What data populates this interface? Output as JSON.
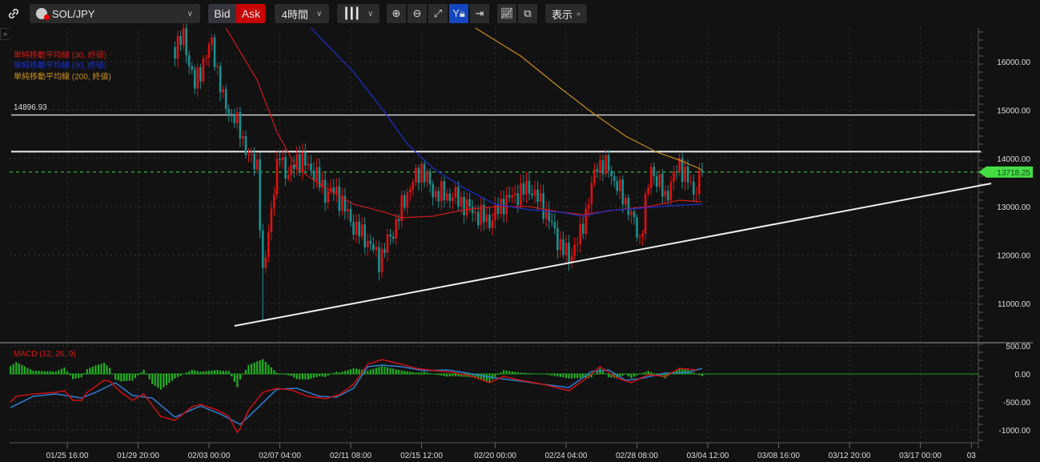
{
  "toolbar": {
    "symbol": "SOL/JPY",
    "bid": "Bid",
    "ask": "Ask",
    "timeframe": "4時間",
    "view": "表示",
    "icons": [
      "link-icon",
      "candlestick-icon",
      "zoom-in-icon",
      "zoom-out-icon",
      "fit-icon",
      "y-lock-icon",
      "jump-to-end-icon",
      "add-indicator-icon",
      "screenshot-icon"
    ]
  },
  "colors": {
    "up": "#e01010",
    "down": "#1a9090",
    "ma30": "#d01818",
    "ma90": "#1a2fd0",
    "ma200": "#c8901a",
    "macd": "#d01010",
    "signal": "#2f7fd0",
    "hist": "#20b020",
    "last": "#44dd44"
  },
  "legend": {
    "ma30": "単純移動平均線 (30, 終値)",
    "ma90": "単純移動平均線 (90, 終値)",
    "ma200": "単純移動平均線 (200, 終値)",
    "macd": "MACD (12, 26, 9)"
  },
  "chart_data": {
    "type": "candlestick",
    "bar_interval": "4h",
    "x_unit": "bars from 02/03 00:00",
    "price_ticks": [
      "16000.00",
      "15000.00",
      "14000.00",
      "13000.00",
      "12000.00",
      "11000.00"
    ],
    "price_tick_values": [
      16000,
      15000,
      14000,
      13000,
      12000,
      11000
    ],
    "macd_ticks": [
      "500.00",
      "0.00",
      "-500.00",
      "-1000.00"
    ],
    "macd_tick_values": [
      500,
      0,
      -500,
      -1000
    ],
    "time_ticks": [
      "01/25 16:00",
      "01/29 20:00",
      "02/03 00:00",
      "02/07 04:00",
      "02/11 08:00",
      "02/15 12:00",
      "02/20 00:00",
      "02/24 04:00",
      "02/28 08:00",
      "03/04 12:00",
      "03/08 16:00",
      "03/12 20:00",
      "03/17 00:00",
      "03"
    ],
    "time_tick_bars": [
      -50,
      -25,
      0,
      25,
      50,
      75,
      101,
      126,
      151,
      176,
      201,
      226,
      251,
      269
    ],
    "close_keypoints": [
      [
        -12,
        16300
      ],
      [
        -9,
        16500
      ],
      [
        -5,
        15500
      ],
      [
        -2,
        16000
      ],
      [
        1,
        16400
      ],
      [
        5,
        15200
      ],
      [
        11,
        14600
      ],
      [
        14,
        14000
      ],
      [
        17,
        13900
      ],
      [
        19,
        11500
      ],
      [
        22,
        13000
      ],
      [
        25,
        14100
      ],
      [
        28,
        13600
      ],
      [
        31,
        14000
      ],
      [
        36,
        13800
      ],
      [
        41,
        13300
      ],
      [
        45,
        13300
      ],
      [
        51,
        12600
      ],
      [
        56,
        12300
      ],
      [
        60,
        11900
      ],
      [
        65,
        12500
      ],
      [
        70,
        13300
      ],
      [
        75,
        13800
      ],
      [
        79,
        13300
      ],
      [
        87,
        13200
      ],
      [
        93,
        12900
      ],
      [
        99,
        12700
      ],
      [
        104,
        13100
      ],
      [
        113,
        13400
      ],
      [
        118,
        13000
      ],
      [
        124,
        12200
      ],
      [
        127,
        11950
      ],
      [
        131,
        12400
      ],
      [
        137,
        13900
      ],
      [
        141,
        13800
      ],
      [
        145,
        13300
      ],
      [
        148,
        13000
      ],
      [
        152,
        12300
      ],
      [
        156,
        13800
      ],
      [
        161,
        13200
      ],
      [
        166,
        13900
      ],
      [
        171,
        13300
      ],
      [
        174,
        13718.25
      ]
    ],
    "spike_low": {
      "bar": 19,
      "price": 10650
    },
    "ma30": [
      [
        6,
        16695
      ],
      [
        17,
        15619
      ],
      [
        24,
        14543
      ],
      [
        31,
        13798
      ],
      [
        39,
        13467
      ],
      [
        51,
        13053
      ],
      [
        62,
        12887
      ],
      [
        68,
        12772
      ],
      [
        79,
        12805
      ],
      [
        90,
        12937
      ],
      [
        101,
        13003
      ],
      [
        113,
        13003
      ],
      [
        124,
        12887
      ],
      [
        132,
        12838
      ],
      [
        144,
        12937
      ],
      [
        155,
        13003
      ],
      [
        166,
        13136
      ],
      [
        174,
        13103
      ]
    ],
    "ma90": [
      [
        36,
        16695
      ],
      [
        51,
        15785
      ],
      [
        62,
        14957
      ],
      [
        70,
        14295
      ],
      [
        79,
        13798
      ],
      [
        90,
        13384
      ],
      [
        101,
        13053
      ],
      [
        113,
        12937
      ],
      [
        124,
        12887
      ],
      [
        132,
        12805
      ],
      [
        141,
        12921
      ],
      [
        152,
        12970
      ],
      [
        163,
        13020
      ],
      [
        174,
        13053
      ]
    ],
    "ma200": [
      [
        94,
        16695
      ],
      [
        110,
        16116
      ],
      [
        124,
        15454
      ],
      [
        135,
        14957
      ],
      [
        147,
        14460
      ],
      [
        158,
        14129
      ],
      [
        166,
        13964
      ],
      [
        174,
        13765
      ]
    ],
    "hlines": [
      {
        "price": 14896.93,
        "label": "14896.93"
      },
      {
        "price": 14140
      }
    ],
    "last_price": 13718.25,
    "last_price_label": "13718.25",
    "trendline": [
      [
        9,
        10536
      ],
      [
        276,
        13482
      ]
    ],
    "macd": [
      [
        -70,
        -500
      ],
      [
        -68,
        -400
      ],
      [
        -62,
        -358
      ],
      [
        -54,
        -329
      ],
      [
        -51,
        -300
      ],
      [
        -48,
        -472
      ],
      [
        -45,
        -472
      ],
      [
        -43,
        -329
      ],
      [
        -37,
        -114
      ],
      [
        -35,
        -129
      ],
      [
        -31,
        -329
      ],
      [
        -27,
        -472
      ],
      [
        -23,
        -358
      ],
      [
        -17,
        -758
      ],
      [
        -12,
        -829
      ],
      [
        -6,
        -586
      ],
      [
        -3,
        -543
      ],
      [
        3,
        -644
      ],
      [
        7,
        -758
      ],
      [
        10,
        -1044
      ],
      [
        11,
        -972
      ],
      [
        14,
        -644
      ],
      [
        19,
        -329
      ],
      [
        24,
        -257
      ],
      [
        29,
        -286
      ],
      [
        35,
        -400
      ],
      [
        41,
        -443
      ],
      [
        46,
        -372
      ],
      [
        51,
        -186
      ],
      [
        56,
        172
      ],
      [
        61,
        257
      ],
      [
        68,
        172
      ],
      [
        73,
        100
      ],
      [
        80,
        57
      ],
      [
        86,
        29
      ],
      [
        93,
        -43
      ],
      [
        99,
        -157
      ],
      [
        104,
        -43
      ],
      [
        110,
        -114
      ],
      [
        118,
        -186
      ],
      [
        127,
        -300
      ],
      [
        134,
        -43
      ],
      [
        138,
        129
      ],
      [
        144,
        -72
      ],
      [
        149,
        -157
      ],
      [
        155,
        -14
      ],
      [
        161,
        -43
      ],
      [
        166,
        100
      ],
      [
        172,
        72
      ]
    ],
    "signal": [
      [
        -70,
        -601
      ],
      [
        -62,
        -400
      ],
      [
        -54,
        -358
      ],
      [
        -45,
        -429
      ],
      [
        -40,
        -329
      ],
      [
        -33,
        -157
      ],
      [
        -27,
        -386
      ],
      [
        -20,
        -429
      ],
      [
        -12,
        -772
      ],
      [
        -3,
        -572
      ],
      [
        4,
        -715
      ],
      [
        11,
        -901
      ],
      [
        17,
        -615
      ],
      [
        24,
        -272
      ],
      [
        31,
        -257
      ],
      [
        39,
        -400
      ],
      [
        45,
        -415
      ],
      [
        51,
        -257
      ],
      [
        56,
        129
      ],
      [
        61,
        157
      ],
      [
        68,
        129
      ],
      [
        76,
        57
      ],
      [
        84,
        72
      ],
      [
        93,
        0
      ],
      [
        101,
        -72
      ],
      [
        110,
        -129
      ],
      [
        118,
        -186
      ],
      [
        127,
        -243
      ],
      [
        135,
        43
      ],
      [
        141,
        72
      ],
      [
        147,
        -114
      ],
      [
        152,
        -86
      ],
      [
        161,
        14
      ],
      [
        169,
        29
      ],
      [
        174,
        100
      ]
    ]
  }
}
